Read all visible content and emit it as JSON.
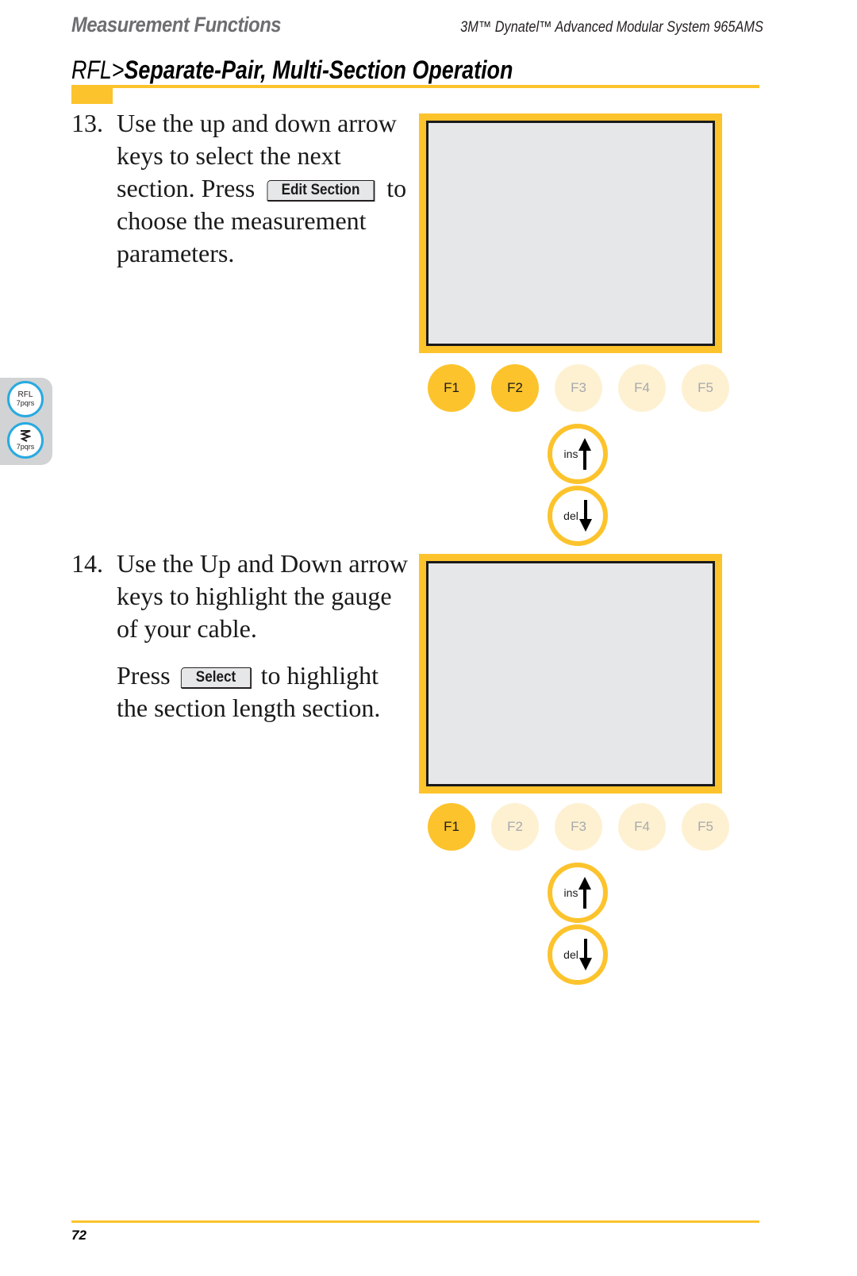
{
  "header": {
    "section": "Measurement Functions",
    "product": "3M™ Dynatel™ Advanced Modular System 965AMS",
    "title_prefix": "RFL>",
    "title_main": "Separate-Pair, Multi-Section Operation"
  },
  "side_tab": {
    "buttons": [
      {
        "line1": "RFL",
        "line2": "7pqrs",
        "icon": "rfl-key"
      },
      {
        "line1": "",
        "line2": "7pqrs",
        "icon": "zigzag-cable-icon"
      }
    ]
  },
  "steps": [
    {
      "number": "13.",
      "text_before": "Use the up and down arrow keys to select the next section. Press",
      "key_label": "Edit Section",
      "text_after": "to choose the measurement parameters.",
      "fkeys": [
        {
          "label": "F1",
          "active": true
        },
        {
          "label": "F2",
          "active": true
        },
        {
          "label": "F3",
          "active": false
        },
        {
          "label": "F4",
          "active": false
        },
        {
          "label": "F5",
          "active": false
        }
      ],
      "arrow_up_label": "ins",
      "arrow_down_label": "del"
    },
    {
      "number": "14.",
      "text": "Use the Up and Down arrow keys to highlight the gauge of your cable.",
      "press_word": "Press",
      "key_label": "Select",
      "text_after": "to highlight the section length section.",
      "fkeys": [
        {
          "label": "F1",
          "active": true
        },
        {
          "label": "F2",
          "active": false
        },
        {
          "label": "F3",
          "active": false
        },
        {
          "label": "F4",
          "active": false
        },
        {
          "label": "F5",
          "active": false
        }
      ],
      "arrow_up_label": "ins",
      "arrow_down_label": "del"
    }
  ],
  "footer": {
    "page_number": "72"
  },
  "colors": {
    "accent": "#fcc32c",
    "accent_light": "#fef1d2",
    "screen_bg": "#e6e7e8",
    "side_button_ring": "#27aae1",
    "side_tab_bg": "#d1d3d4"
  }
}
